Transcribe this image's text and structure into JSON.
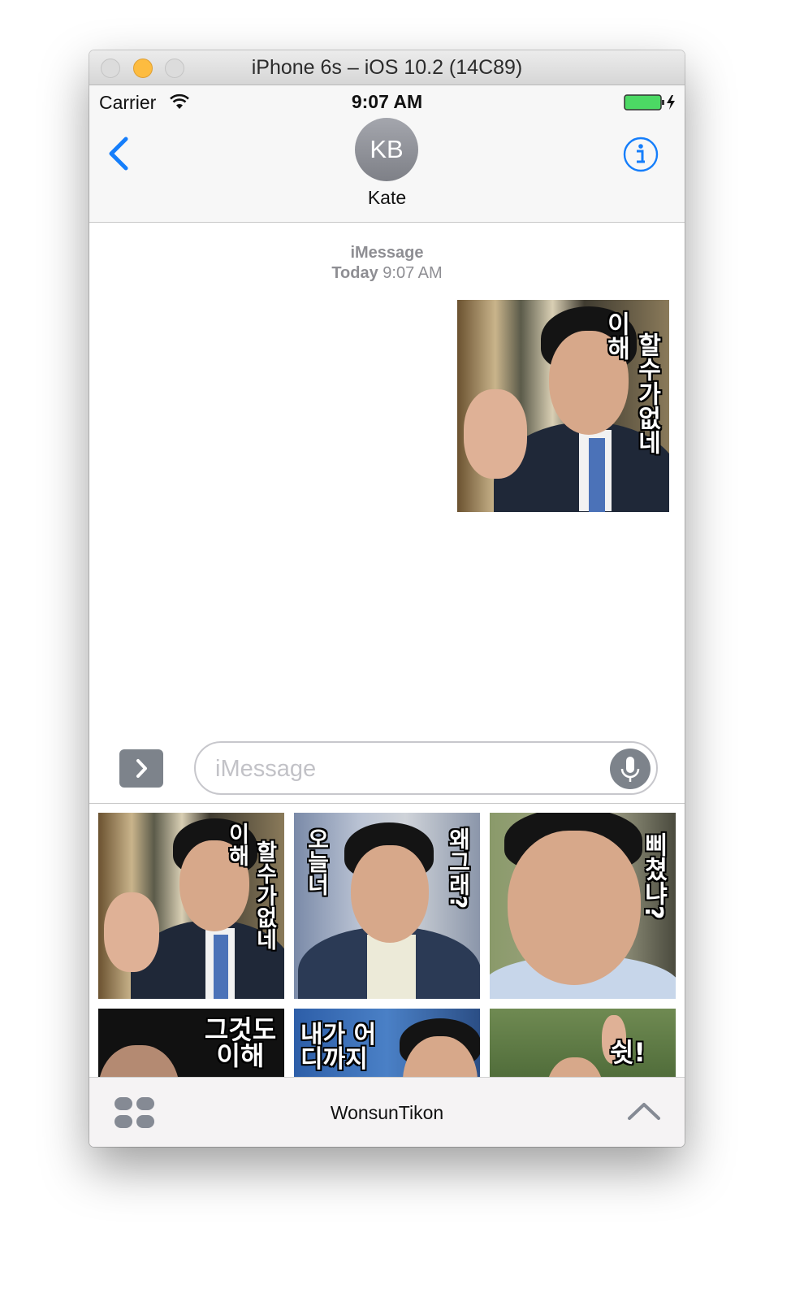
{
  "window": {
    "title": "iPhone 6s – iOS 10.2 (14C89)"
  },
  "status_bar": {
    "carrier": "Carrier",
    "time": "9:07 AM"
  },
  "header": {
    "avatar_initials": "KB",
    "contact_name": "Kate"
  },
  "conversation": {
    "service": "iMessage",
    "timestamp_day": "Today",
    "timestamp_time": "9:07 AM",
    "sticker": {
      "caption_left": "이해",
      "caption_right": "할수가없네"
    }
  },
  "input": {
    "placeholder": "iMessage"
  },
  "sticker_drawer": {
    "stickers": [
      {
        "caption_left": "이해",
        "caption_right": "할수가없네"
      },
      {
        "caption_left": "오늘너",
        "caption_right": "왜그래?"
      },
      {
        "caption_right": "삐쳤냐?"
      },
      {
        "caption": "그것도 이해"
      },
      {
        "caption": "내가 어디까지"
      },
      {
        "caption": "쉿!"
      }
    ]
  },
  "app_bar": {
    "app_name": "WonsunTikon"
  },
  "colors": {
    "ios_blue": "#157efb",
    "gray_button": "#7d838b",
    "battery_green": "#4cd964"
  },
  "icons": [
    "back-chevron-icon",
    "info-icon",
    "wifi-icon",
    "battery-icon",
    "expand-arrow-icon",
    "microphone-icon",
    "app-drawer-icon",
    "chevron-up-icon"
  ]
}
